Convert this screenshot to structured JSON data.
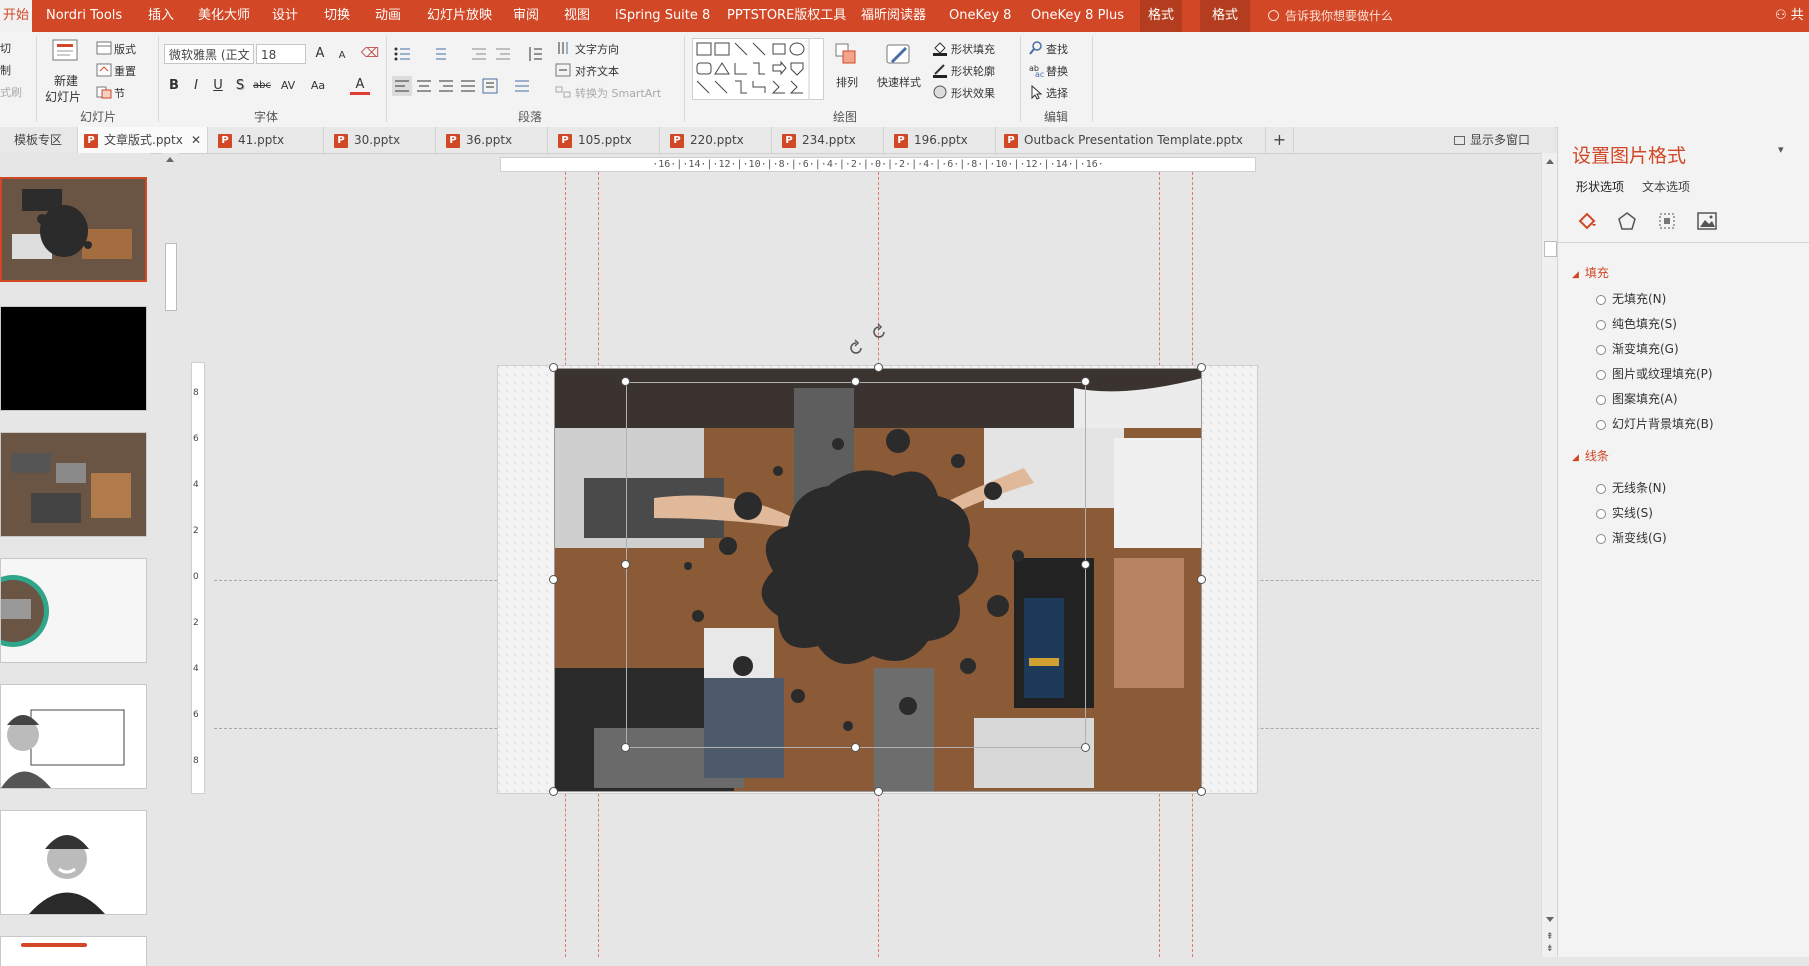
{
  "ribbon": {
    "tabs": [
      {
        "label": "开始",
        "selected": true
      },
      {
        "label": "Nordri Tools"
      },
      {
        "label": "插入"
      },
      {
        "label": "美化大师"
      },
      {
        "label": "设计"
      },
      {
        "label": "切换"
      },
      {
        "label": "动画"
      },
      {
        "label": "幻灯片放映"
      },
      {
        "label": "审阅"
      },
      {
        "label": "视图"
      },
      {
        "label": "iSpring Suite 8"
      },
      {
        "label": "PPTSTORE版权工具"
      },
      {
        "label": "福昕阅读器"
      },
      {
        "label": "OneKey 8"
      },
      {
        "label": "OneKey 8 Plus"
      },
      {
        "label": "格式"
      },
      {
        "label": "格式"
      }
    ],
    "tell_me": "告诉我你想要做什么",
    "share": "共",
    "clipboard": {
      "cut": "切",
      "copy": "制",
      "painter": "式刷"
    },
    "slides": {
      "new_slide": "新建",
      "new_slide2": "幻灯片",
      "layout": "版式",
      "reset": "重置",
      "section": "节",
      "label": "幻灯片"
    },
    "font": {
      "name": "微软雅黑 (正文",
      "size": "18",
      "bold": "B",
      "italic": "I",
      "underline": "U",
      "shadow": "S",
      "strike": "abc",
      "spacing": "AV",
      "case": "Aa",
      "color": "A",
      "grow": "A",
      "shrink": "A",
      "label": "字体"
    },
    "paragraph": {
      "text_direction": "文字方向",
      "align_text": "对齐文本",
      "smartart": "转换为 SmartArt",
      "label": "段落"
    },
    "drawing": {
      "arrange": "排列",
      "quick_styles": "快速样式",
      "shape_fill": "形状填充",
      "shape_outline": "形状轮廓",
      "shape_effects": "形状效果",
      "label": "绘图"
    },
    "editing": {
      "find": "查找",
      "replace": "替换",
      "select": "选择",
      "label": "编辑"
    }
  },
  "doc_tabs": {
    "template_zone": "模板专区",
    "items": [
      {
        "label": "文章版式.pptx",
        "active": true
      },
      {
        "label": "41.pptx"
      },
      {
        "label": "30.pptx"
      },
      {
        "label": "36.pptx"
      },
      {
        "label": "105.pptx"
      },
      {
        "label": "220.pptx"
      },
      {
        "label": "234.pptx"
      },
      {
        "label": "196.pptx"
      },
      {
        "label": "Outback Presentation Template.pptx"
      }
    ],
    "add": "+",
    "multi_window": "显示多窗口"
  },
  "ruler": {
    "h_ticks": "·16·|·14·|·12·|·10·|·8·|·6·|·4·|·2·|·0·|·2·|·4·|·6·|·8·|·10·|·12·|·14·|·16·",
    "v_ticks": [
      "8",
      "6",
      "4",
      "2",
      "0",
      "2",
      "4",
      "6",
      "8"
    ]
  },
  "format_pane": {
    "title": "设置图片格式",
    "tabs": [
      "形状选项",
      "文本选项"
    ],
    "fill": {
      "heading": "填充",
      "options": [
        "无填充(N)",
        "纯色填充(S)",
        "渐变填充(G)",
        "图片或纹理填充(P)",
        "图案填充(A)",
        "幻灯片背景填充(B)"
      ]
    },
    "line": {
      "heading": "线条",
      "options": [
        "无线条(N)",
        "实线(S)",
        "渐变线(G)"
      ]
    }
  },
  "colors": {
    "accent": "#d24726",
    "teal": "#2fa58a",
    "splat": "#2b2b2b"
  }
}
